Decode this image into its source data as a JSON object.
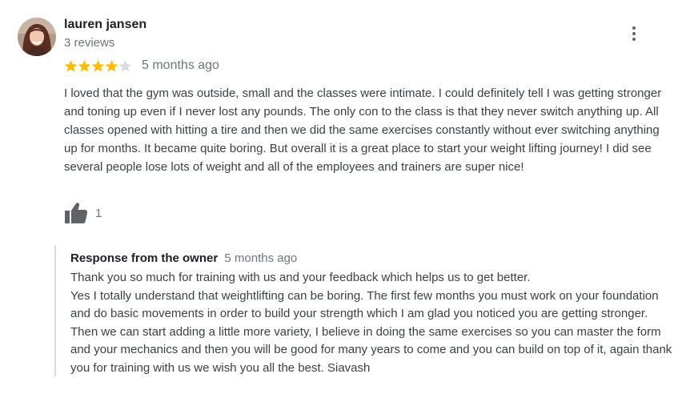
{
  "review": {
    "reviewer_name": "lauren jansen",
    "review_count": "3 reviews",
    "rating": 4,
    "rating_max": 5,
    "date": "5 months ago",
    "text": "I loved that the gym was outside, small and the classes were intimate. I could definitely tell I was getting stronger and toning up even if I never lost any pounds. The only con to the class is that they never switch anything up. All classes opened with hitting a tire and then we did the same exercises constantly without ever switching anything up for months. It became quite boring. But overall it is a great place to start your weight lifting journey! I did see several people lose lots of weight and all of the employees and trainers are super nice!",
    "like_count": "1",
    "icons": {
      "avatar": "user-avatar",
      "menu": "more-vert-icon",
      "like": "thumb-up-icon",
      "star": "star-icon"
    }
  },
  "response": {
    "title": "Response from the owner",
    "date": "5 months ago",
    "lines": [
      "Thank you so much for training with us and your feedback which helps us to get better.",
      "Yes I totally understand that weightlifting can be boring. The first few months you must work on your foundation and do basic movements in order to build your strength which I am glad you noticed you are getting stronger. Then we can start adding a little more variety, I believe in doing the same exercises so you can master the form and your mechanics and then you will be good for many years to come and you can build on top of it, again thank you for training with us we wish you all the best. Siavash"
    ]
  },
  "colors": {
    "star_filled": "#fbbc04",
    "star_empty": "#dadce0",
    "muted_text": "#70757a",
    "body_text": "#3c4043",
    "icon_gray": "#5f6368",
    "divider": "#dadce0"
  }
}
